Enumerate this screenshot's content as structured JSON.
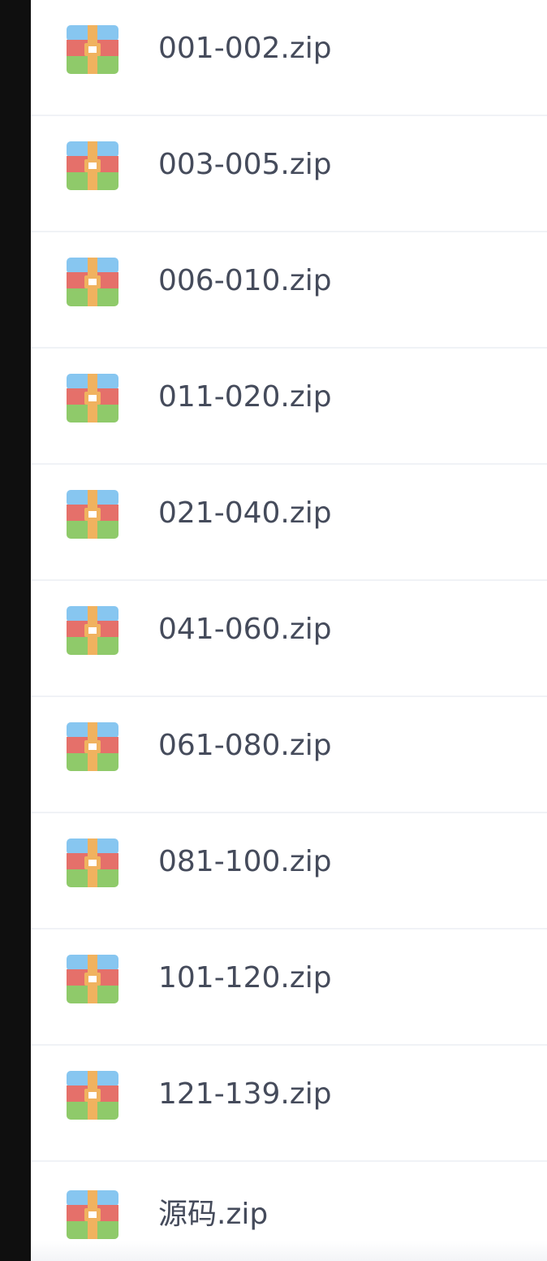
{
  "icon": {
    "name": "zip-archive-icon",
    "colors": {
      "top": "#87c6f0",
      "middle": "#e5706a",
      "bottom": "#8fca6a",
      "zipper": "#f0b25f",
      "clasp": "#ffffff"
    }
  },
  "files": [
    {
      "name": "001-002.zip"
    },
    {
      "name": "003-005.zip"
    },
    {
      "name": "006-010.zip"
    },
    {
      "name": "011-020.zip"
    },
    {
      "name": "021-040.zip"
    },
    {
      "name": "041-060.zip"
    },
    {
      "name": "061-080.zip"
    },
    {
      "name": "081-100.zip"
    },
    {
      "name": "101-120.zip"
    },
    {
      "name": "121-139.zip"
    },
    {
      "name": "源码.zip"
    }
  ]
}
